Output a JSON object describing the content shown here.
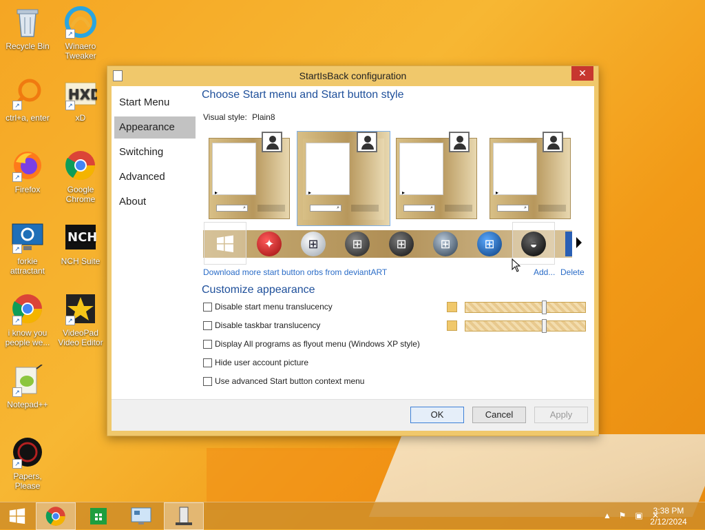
{
  "desktop": {
    "icons": [
      {
        "label": "Recycle Bin"
      },
      {
        "label": "Winaero Tweaker"
      },
      {
        "label": "ctrl+a, enter"
      },
      {
        "label": "xD"
      },
      {
        "label": "Firefox"
      },
      {
        "label": "Google Chrome"
      },
      {
        "label": "forkie attractant"
      },
      {
        "label": "NCH Suite"
      },
      {
        "label": "i know you people we..."
      },
      {
        "label": "VideoPad Video Editor"
      },
      {
        "label": "Notepad++"
      },
      {
        "label": "Papers, Please"
      }
    ]
  },
  "dialog": {
    "title": "StartIsBack configuration",
    "close_symbol": "✕",
    "nav": [
      {
        "label": "Start Menu"
      },
      {
        "label": "Appearance"
      },
      {
        "label": "Switching"
      },
      {
        "label": "Advanced"
      },
      {
        "label": "About"
      }
    ],
    "selected_nav": "Appearance",
    "section1_title": "Choose Start menu and Start button style",
    "visual_style_label": "Visual style:",
    "visual_style_value": "Plain8",
    "download_link": "Download more start button orbs from deviantART",
    "add_link": "Add...",
    "delete_link": "Delete",
    "section2_title": "Customize appearance",
    "options": [
      {
        "label": "Disable start menu translucency",
        "checked": false
      },
      {
        "label": "Disable taskbar translucency",
        "checked": false
      },
      {
        "label": "Display All programs as flyout menu (Windows XP style)",
        "checked": false
      },
      {
        "label": "Hide user account picture",
        "checked": false
      },
      {
        "label": "Use advanced Start button context menu",
        "checked": false
      }
    ],
    "swatch_color": "#f0c86b",
    "buttons": {
      "ok": "OK",
      "cancel": "Cancel",
      "apply": "Apply"
    }
  },
  "taskbar": {
    "time": "3:38 PM",
    "date": "2/12/2024"
  },
  "colors": {
    "accent": "#f0c86b",
    "link": "#2a6cc7",
    "heading": "#1e4f9a",
    "close": "#c7372f"
  }
}
